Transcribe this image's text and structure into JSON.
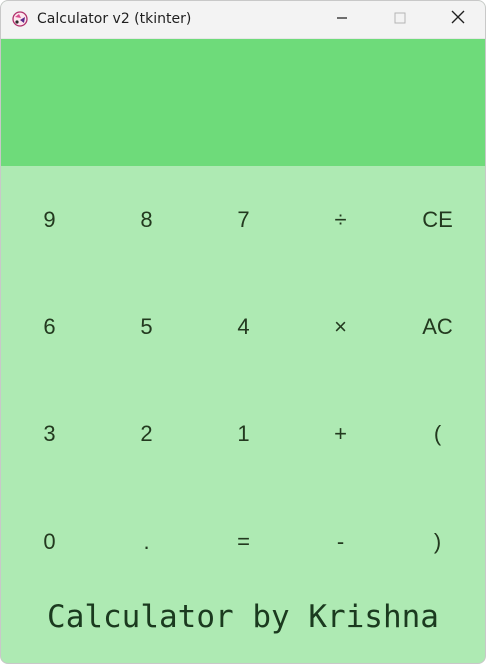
{
  "window": {
    "title": "Calculator v2 (tkinter)",
    "controls": {
      "minimize_icon": "minimize-icon",
      "maximize_icon": "maximize-icon",
      "close_icon": "close-icon"
    }
  },
  "display": {
    "value": ""
  },
  "keys": [
    [
      "9",
      "8",
      "7",
      "÷",
      "CE"
    ],
    [
      "6",
      "5",
      "4",
      "×",
      "AC"
    ],
    [
      "3",
      "2",
      "1",
      "+",
      "("
    ],
    [
      "0",
      ".",
      "=",
      "-",
      ")"
    ]
  ],
  "footer": {
    "text": "Calculator by Krishna"
  },
  "colors": {
    "display_bg": "#6edb7a",
    "keypad_bg": "#aeeab3",
    "text": "#23391f",
    "titlebar_bg": "#f3f3f3"
  }
}
